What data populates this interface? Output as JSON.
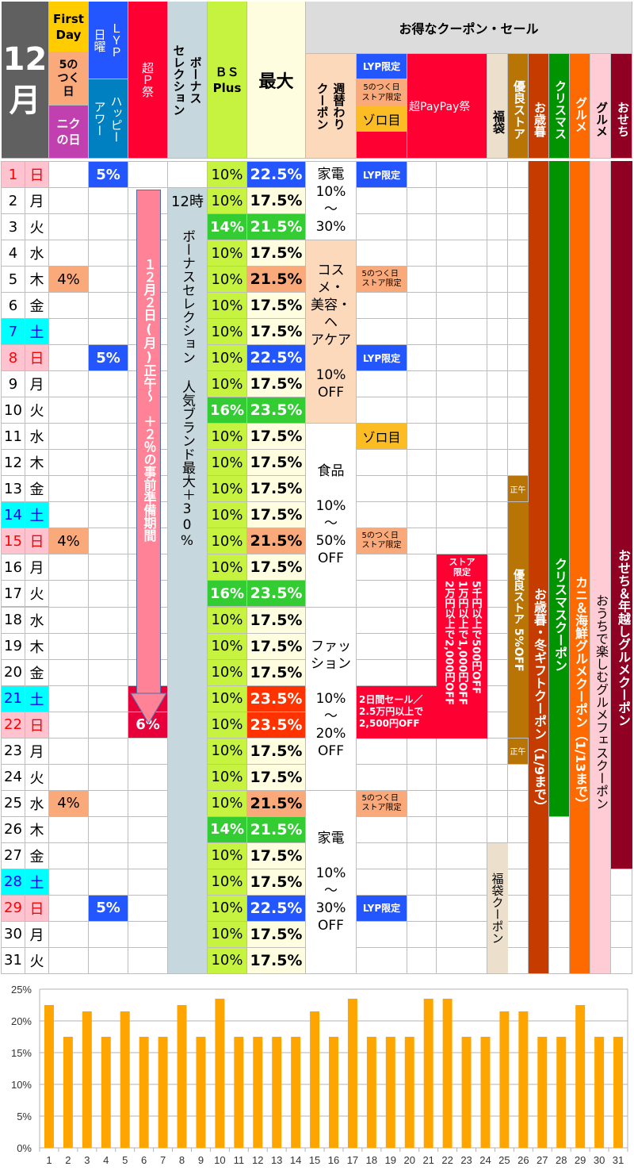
{
  "header": {
    "month": "12\n月",
    "first_day": "First Day",
    "five_day": "5の\nつく\n日",
    "niku_day": "ニク\nの日",
    "lyp_sunday": "ＬＹＰ\n日曜",
    "happy_hour": "ハッピー\nアワー",
    "cho_p": "超Ｐ祭",
    "bonus_selection": "ボーナス\nセレクション",
    "bs_plus": "ＢＳ\nPlus",
    "max": "最大",
    "coupon_sale_title": "お得なクーポン・セール",
    "weekly_coupon": "週替わり\nクーポン",
    "lyp_limited": "LYP限定",
    "five_store_limited": "5のつく日\nストア限定",
    "zorome": "ゾロ目",
    "cho_paypay": "超PayPay祭",
    "fukubukuro": "福袋",
    "yuryo_store": "優良ストア",
    "oseibo": "お歳暮",
    "christmas": "クリスマス",
    "gourmet": "グルメ",
    "gourmet2": "グルメ",
    "osechi": "おせち"
  },
  "colors": {
    "month_bg": "#606060",
    "first_day": "#ffcc00",
    "five_day": "#f9a97a",
    "niku_day": "#c040b0",
    "lyp_blue": "#2456ff",
    "happy_hour": "#0080c0",
    "cho_p_red": "#ff0033",
    "bonus_gray": "#c6d7de",
    "bs_plus_lime": "#c6f240",
    "bs_plus_green": "#33cc33",
    "max_cream": "#fffde0",
    "max_orange": "#ff3300",
    "weekly_peach": "#fcd9bb",
    "zorome": "#fbbc24",
    "fukubukuro": "#ecdfcc",
    "yuryo": "#b87506",
    "oseibo": "#c63b00",
    "christmas": "#009400",
    "gourmet_orange": "#ff6a00",
    "gourmet_pink": "#ffccd5",
    "osechi": "#8f0023",
    "sunday_bg": "#ffc3cf",
    "saturday_bg": "#00ffff",
    "bar": "#ffa500"
  },
  "days": [
    {
      "d": "1",
      "w": "日",
      "type": "sun",
      "first": "",
      "lyp": "5%",
      "chop": "",
      "bonus": "",
      "bs": "10%",
      "max": "22.5%",
      "maxc": "blue",
      "bsc": "lime"
    },
    {
      "d": "2",
      "w": "月",
      "type": "",
      "first": "",
      "lyp": "",
      "chop": "",
      "bonus": "12時",
      "bs": "10%",
      "max": "17.5%",
      "maxc": "cream",
      "bsc": "lime"
    },
    {
      "d": "3",
      "w": "火",
      "type": "",
      "first": "",
      "lyp": "",
      "chop": "",
      "bonus": "",
      "bs": "14%",
      "max": "21.5%",
      "maxc": "green",
      "bsc": "green"
    },
    {
      "d": "4",
      "w": "水",
      "type": "",
      "first": "",
      "lyp": "",
      "chop": "",
      "bonus": "",
      "bs": "10%",
      "max": "17.5%",
      "maxc": "cream",
      "bsc": "lime"
    },
    {
      "d": "5",
      "w": "木",
      "type": "",
      "first": "4%",
      "lyp": "",
      "chop": "",
      "bonus": "",
      "bs": "10%",
      "max": "21.5%",
      "maxc": "peach",
      "bsc": "lime"
    },
    {
      "d": "6",
      "w": "金",
      "type": "",
      "first": "",
      "lyp": "",
      "chop": "",
      "bonus": "",
      "bs": "10%",
      "max": "17.5%",
      "maxc": "cream",
      "bsc": "lime"
    },
    {
      "d": "7",
      "w": "土",
      "type": "sat",
      "first": "",
      "lyp": "",
      "chop": "",
      "bonus": "",
      "bs": "10%",
      "max": "17.5%",
      "maxc": "cream",
      "bsc": "lime"
    },
    {
      "d": "8",
      "w": "日",
      "type": "sun",
      "first": "",
      "lyp": "5%",
      "chop": "",
      "bonus": "",
      "bs": "10%",
      "max": "22.5%",
      "maxc": "blue",
      "bsc": "lime"
    },
    {
      "d": "9",
      "w": "月",
      "type": "",
      "first": "",
      "lyp": "",
      "chop": "",
      "bonus": "",
      "bs": "10%",
      "max": "17.5%",
      "maxc": "cream",
      "bsc": "lime"
    },
    {
      "d": "10",
      "w": "火",
      "type": "",
      "first": "",
      "lyp": "",
      "chop": "",
      "bonus": "",
      "bs": "16%",
      "max": "23.5%",
      "maxc": "green",
      "bsc": "green"
    },
    {
      "d": "11",
      "w": "水",
      "type": "",
      "first": "",
      "lyp": "",
      "chop": "",
      "bonus": "",
      "bs": "10%",
      "max": "17.5%",
      "maxc": "cream",
      "bsc": "lime"
    },
    {
      "d": "12",
      "w": "木",
      "type": "",
      "first": "",
      "lyp": "",
      "chop": "",
      "bonus": "",
      "bs": "10%",
      "max": "17.5%",
      "maxc": "cream",
      "bsc": "lime"
    },
    {
      "d": "13",
      "w": "金",
      "type": "",
      "first": "",
      "lyp": "",
      "chop": "",
      "bonus": "",
      "bs": "10%",
      "max": "17.5%",
      "maxc": "cream",
      "bsc": "lime"
    },
    {
      "d": "14",
      "w": "土",
      "type": "sat",
      "first": "",
      "lyp": "",
      "chop": "",
      "bonus": "",
      "bs": "10%",
      "max": "17.5%",
      "maxc": "cream",
      "bsc": "lime"
    },
    {
      "d": "15",
      "w": "日",
      "type": "sun",
      "first": "4%",
      "lyp": "",
      "chop": "",
      "bonus": "",
      "bs": "10%",
      "max": "21.5%",
      "maxc": "peach",
      "bsc": "lime"
    },
    {
      "d": "16",
      "w": "月",
      "type": "",
      "first": "",
      "lyp": "",
      "chop": "",
      "bonus": "",
      "bs": "10%",
      "max": "17.5%",
      "maxc": "cream",
      "bsc": "lime"
    },
    {
      "d": "17",
      "w": "火",
      "type": "",
      "first": "",
      "lyp": "",
      "chop": "",
      "bonus": "",
      "bs": "16%",
      "max": "23.5%",
      "maxc": "green",
      "bsc": "green"
    },
    {
      "d": "18",
      "w": "水",
      "type": "",
      "first": "",
      "lyp": "",
      "chop": "",
      "bonus": "",
      "bs": "10%",
      "max": "17.5%",
      "maxc": "cream",
      "bsc": "lime"
    },
    {
      "d": "19",
      "w": "木",
      "type": "",
      "first": "",
      "lyp": "",
      "chop": "",
      "bonus": "",
      "bs": "10%",
      "max": "17.5%",
      "maxc": "cream",
      "bsc": "lime"
    },
    {
      "d": "20",
      "w": "金",
      "type": "",
      "first": "",
      "lyp": "",
      "chop": "",
      "bonus": "",
      "bs": "10%",
      "max": "17.5%",
      "maxc": "cream",
      "bsc": "lime"
    },
    {
      "d": "21",
      "w": "土",
      "type": "sat",
      "first": "",
      "lyp": "",
      "chop": "6%",
      "bonus": "",
      "bs": "10%",
      "max": "23.5%",
      "maxc": "red",
      "bsc": "lime"
    },
    {
      "d": "22",
      "w": "日",
      "type": "sun",
      "first": "",
      "lyp": "",
      "chop": "6%",
      "bonus": "",
      "bs": "10%",
      "max": "23.5%",
      "maxc": "red",
      "bsc": "lime"
    },
    {
      "d": "23",
      "w": "月",
      "type": "",
      "first": "",
      "lyp": "",
      "chop": "",
      "bonus": "",
      "bs": "10%",
      "max": "17.5%",
      "maxc": "cream",
      "bsc": "lime"
    },
    {
      "d": "24",
      "w": "火",
      "type": "",
      "first": "",
      "lyp": "",
      "chop": "",
      "bonus": "",
      "bs": "10%",
      "max": "17.5%",
      "maxc": "cream",
      "bsc": "lime"
    },
    {
      "d": "25",
      "w": "水",
      "type": "",
      "first": "4%",
      "lyp": "",
      "chop": "",
      "bonus": "",
      "bs": "10%",
      "max": "21.5%",
      "maxc": "peach",
      "bsc": "lime"
    },
    {
      "d": "26",
      "w": "木",
      "type": "",
      "first": "",
      "lyp": "",
      "chop": "",
      "bonus": "",
      "bs": "14%",
      "max": "21.5%",
      "maxc": "green",
      "bsc": "green"
    },
    {
      "d": "27",
      "w": "金",
      "type": "",
      "first": "",
      "lyp": "",
      "chop": "",
      "bonus": "",
      "bs": "10%",
      "max": "17.5%",
      "maxc": "cream",
      "bsc": "lime"
    },
    {
      "d": "28",
      "w": "土",
      "type": "sat",
      "first": "",
      "lyp": "",
      "chop": "",
      "bonus": "",
      "bs": "10%",
      "max": "17.5%",
      "maxc": "cream",
      "bsc": "lime"
    },
    {
      "d": "29",
      "w": "日",
      "type": "sun",
      "first": "",
      "lyp": "5%",
      "chop": "",
      "bonus": "",
      "bs": "10%",
      "max": "22.5%",
      "maxc": "blue",
      "bsc": "lime"
    },
    {
      "d": "30",
      "w": "月",
      "type": "",
      "first": "",
      "lyp": "",
      "chop": "",
      "bonus": "",
      "bs": "10%",
      "max": "17.5%",
      "maxc": "cream",
      "bsc": "lime"
    },
    {
      "d": "31",
      "w": "火",
      "type": "",
      "first": "",
      "lyp": "",
      "chop": "",
      "bonus": "",
      "bs": "10%",
      "max": "17.5%",
      "maxc": "cream",
      "bsc": "lime"
    }
  ],
  "spans": {
    "prep_arrow": "１２月２日(月)正午～　＋２％の事前準備期間",
    "bonus_selection_span": "ボーナスセレクション 人気ブランド最大＋30%",
    "weekly": [
      {
        "text": "家電\n10%\n～\n30%",
        "start": 1,
        "end": 3,
        "bg": "white"
      },
      {
        "text": "コスメ・\n美容・ヘ\nアケア\n\n10%\nOFF",
        "start": 4,
        "end": 10,
        "bg": "peach"
      },
      {
        "text": "食品\n\n10%\n～\n50%\nOFF",
        "start": 11,
        "end": 17,
        "bg": "white"
      },
      {
        "text": "ファッション\n\n10%\n～\n20%\nOFF",
        "start": 18,
        "end": 24,
        "bg": "white"
      },
      {
        "text": "家電\n\n10%\n～\n30%\nOFF",
        "start": 25,
        "end": 31,
        "bg": "white"
      }
    ],
    "lyp_limited_days": [
      1,
      8,
      29
    ],
    "five_store_days": [
      5,
      15,
      25
    ],
    "zorome_days": [
      11
    ],
    "lyp_label": "LYP限定",
    "five_store_label": "5のつく日\nストア限定",
    "zorome_label": "ゾロ目",
    "two_day_sale": "2日間セール／2.5万円以上で2,500円OFF",
    "store_limited_title": "ストア\n限定",
    "store_limited_lines": [
      "5千円以上で500円OFF",
      "1万円以上で1,000円OFF",
      "2万円以上で2,000円OFF"
    ],
    "yuryo_noon": "正午",
    "yuryo_text": "優良ストア 5%OFF",
    "fukubukuro_text": "福袋クーポン",
    "oseibo_text": "お歳暮・冬ギフトクーポン（1/9まで）",
    "christmas_text": "クリスマスクーポン",
    "kani_text": "カニ＆海鮮グルメクーポン（1/13まで）",
    "gourmet_fes_text": "おうちで楽しむグルメフェスクーポン",
    "osechi_text": "おせち＆年越しグルメクーポン"
  },
  "chart_data": {
    "type": "bar",
    "title": "",
    "xlabel": "",
    "ylabel": "",
    "categories": [
      "1",
      "2",
      "3",
      "4",
      "5",
      "6",
      "7",
      "8",
      "9",
      "10",
      "11",
      "12",
      "13",
      "14",
      "15",
      "16",
      "17",
      "18",
      "19",
      "20",
      "21",
      "22",
      "23",
      "24",
      "25",
      "26",
      "27",
      "28",
      "29",
      "30",
      "31"
    ],
    "values": [
      22.5,
      17.5,
      21.5,
      17.5,
      21.5,
      17.5,
      17.5,
      22.5,
      17.5,
      23.5,
      17.5,
      17.5,
      17.5,
      17.5,
      21.5,
      17.5,
      23.5,
      17.5,
      17.5,
      17.5,
      23.5,
      23.5,
      17.5,
      17.5,
      21.5,
      21.5,
      17.5,
      17.5,
      22.5,
      17.5,
      17.5
    ],
    "ylim": [
      0,
      25
    ],
    "yticks": [
      "0%",
      "5%",
      "10%",
      "15%",
      "20%",
      "25%"
    ],
    "grid": true,
    "color": "#ffa500"
  }
}
